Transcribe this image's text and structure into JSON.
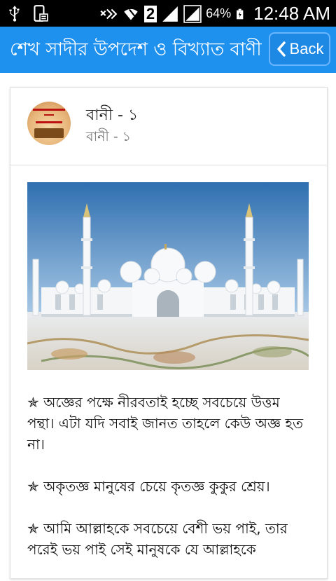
{
  "status_bar": {
    "battery_percent": "64%",
    "time": "12:48 AM",
    "sim_label": "2"
  },
  "app_bar": {
    "title": "শেখ সাদীর উপদেশ ও বিখ্যাত বাণী",
    "back_label": "Back",
    "color": "#1e90ee"
  },
  "card": {
    "title": "বানী - ১",
    "subtitle": "বানী - ১",
    "image_icon": "mosque-image",
    "paragraphs": [
      "✯ অজ্ঞের পক্ষে নীরবতাই হচ্ছে সবচেয়ে উত্তম পন্থা। এটা যদি সবাই জানত তাহলে কেউ অজ্ঞ হত না।",
      "✯ অকৃতজ্ঞ মানুষের চেয়ে কৃতজ্ঞ কুকুর শ্রেয়।",
      "✯ আমি আল্লাহকে সবচেয়ে বেশী ভয় পাই, তার পরেই ভয় পাই সেই মানুষকে যে আল্লাহকে"
    ]
  }
}
